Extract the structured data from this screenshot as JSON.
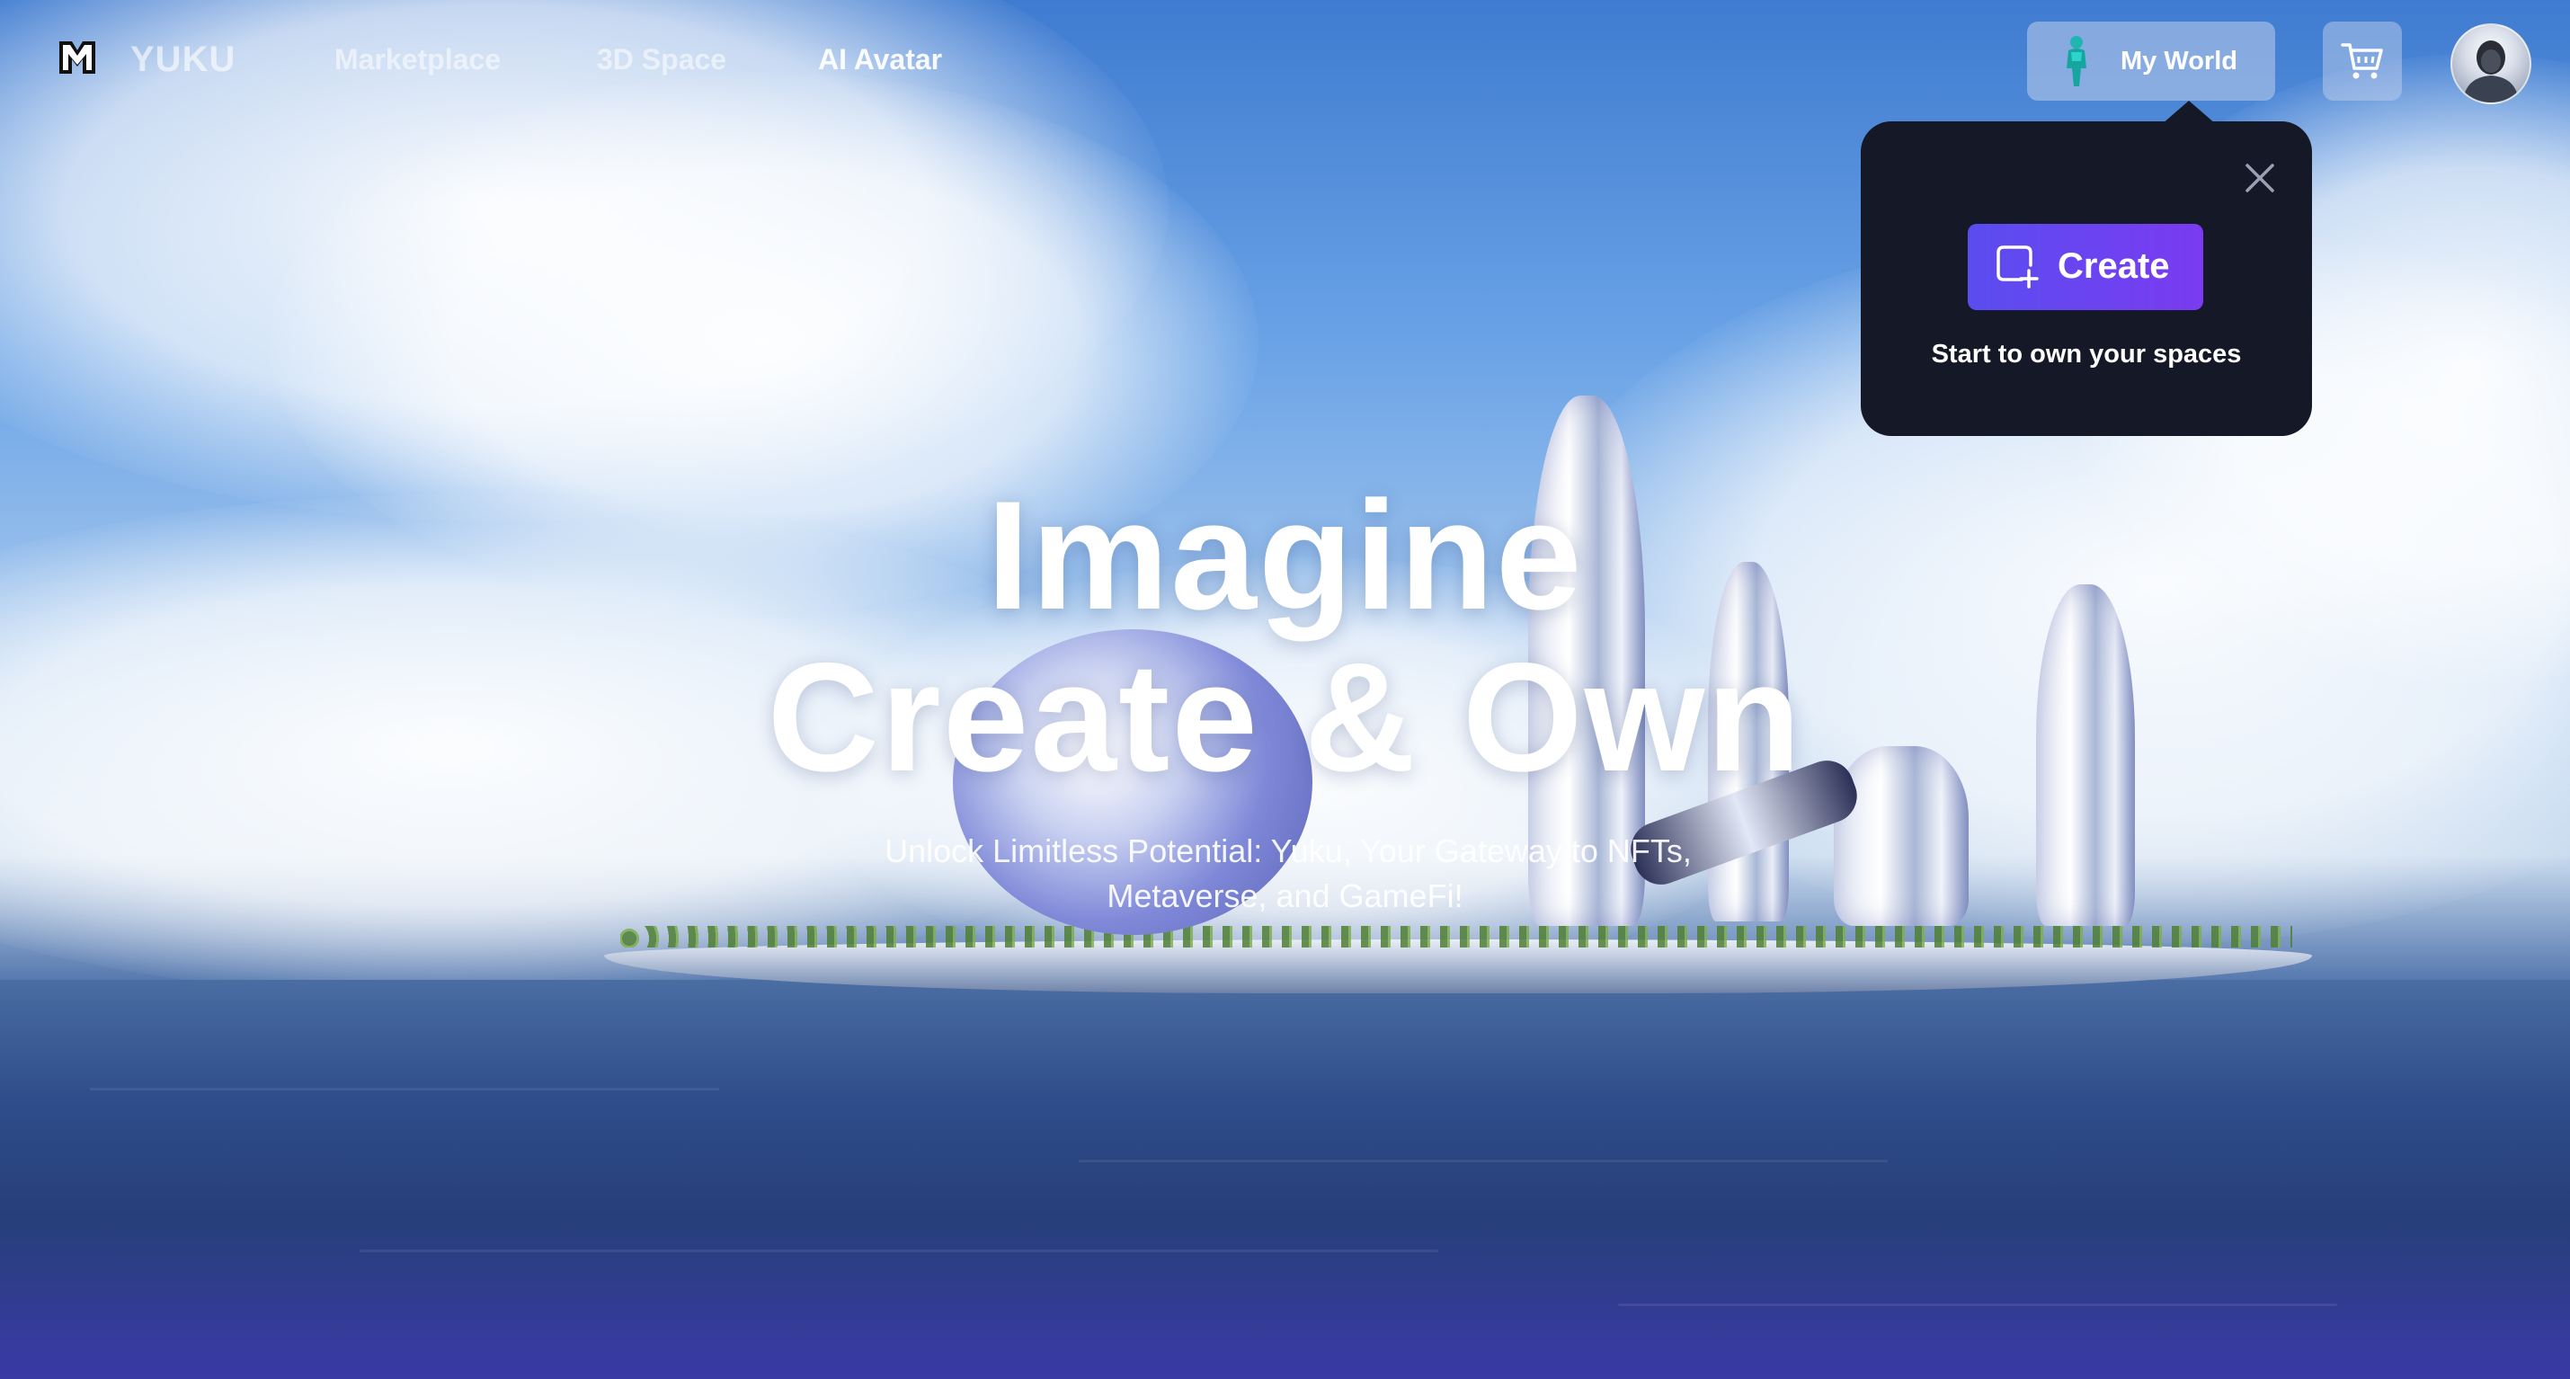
{
  "nav": {
    "brand": "YUKU",
    "links": [
      "Marketplace",
      "3D Space",
      "AI Avatar"
    ],
    "my_world_label": "My World"
  },
  "popover": {
    "create_label": "Create",
    "caption": "Start to own your spaces"
  },
  "hero": {
    "title_line1": "Imagine",
    "title_line2": "Create & Own",
    "subtitle_line1": "Unlock Limitless Potential: Yuku, Your Gateway to NFTs,",
    "subtitle_line2": "Metaverse, and GameFi!"
  },
  "colors": {
    "popover_bg": "#151827",
    "create_gradient_start": "#5a4df0",
    "create_gradient_end": "#7a3bf0"
  },
  "icons": {
    "logo": "yuku-logo-icon",
    "my_world": "avatar-figure-icon",
    "cart": "cart-icon",
    "close": "close-icon",
    "create": "create-plus-icon"
  }
}
